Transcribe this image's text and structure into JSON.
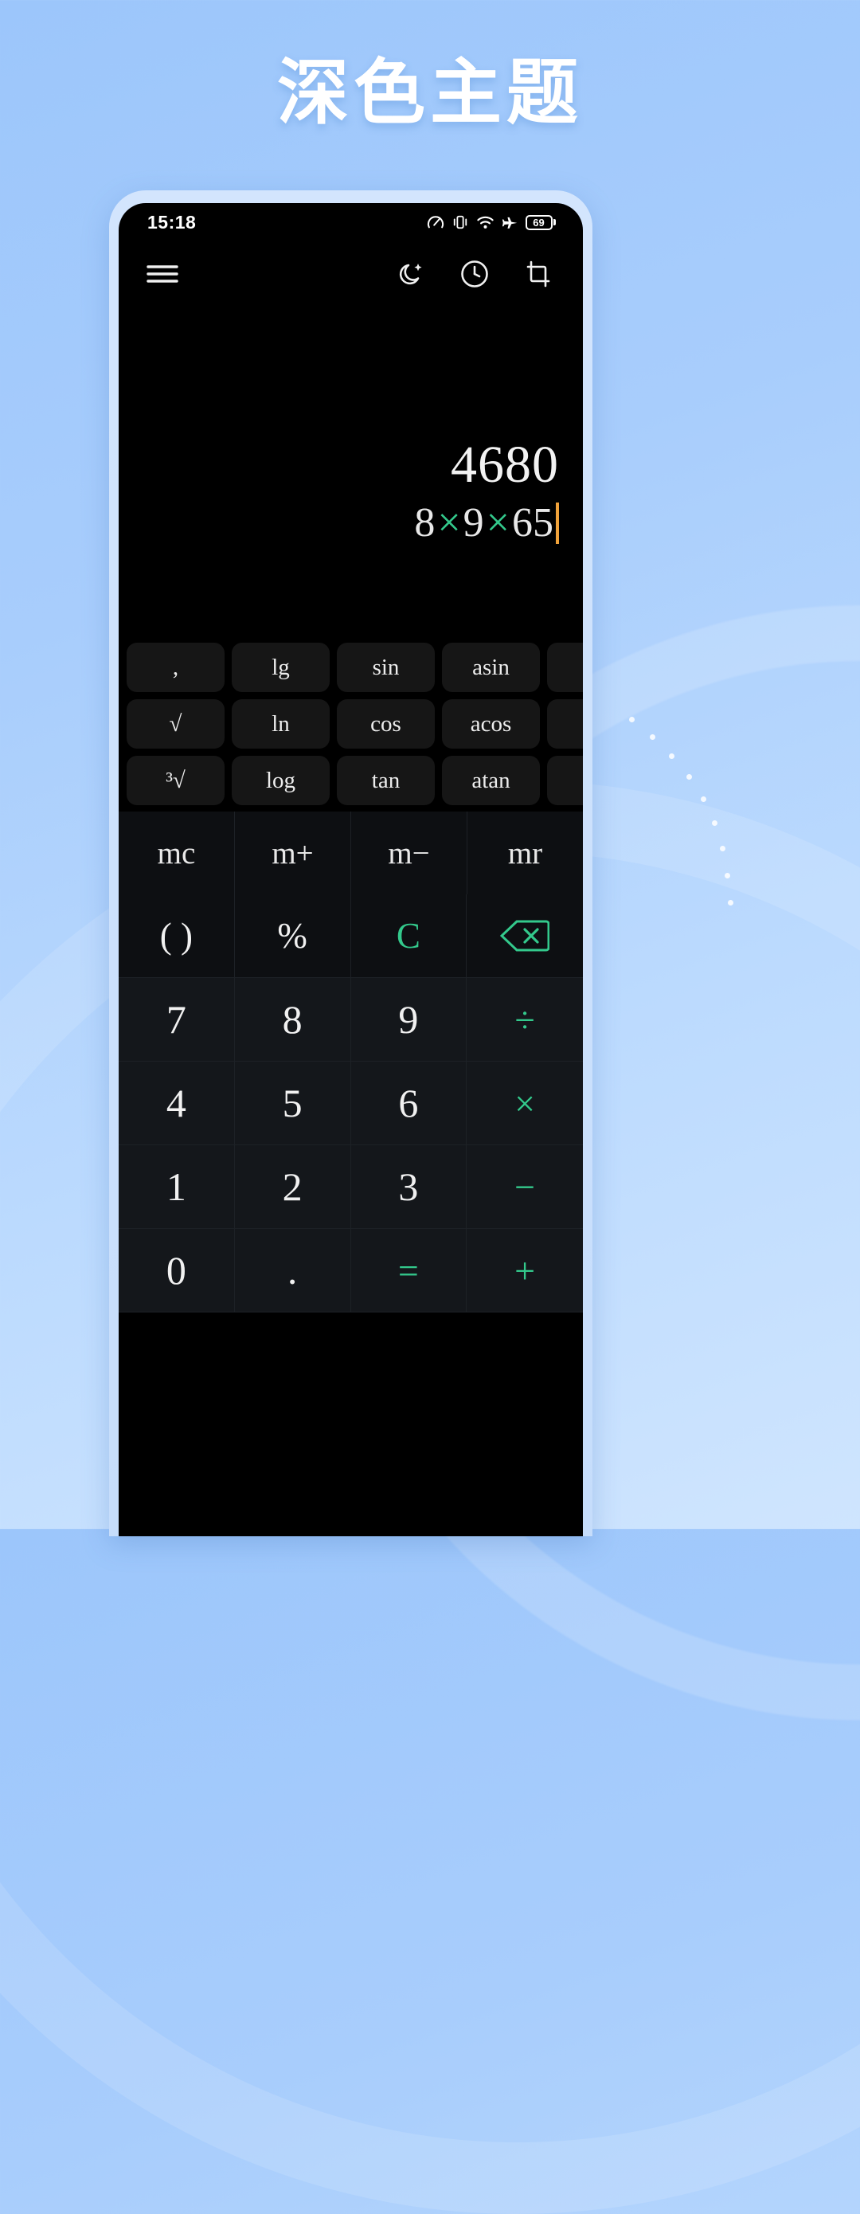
{
  "page": {
    "title": "深色主题",
    "background_accent": "#9cc6fb"
  },
  "statusbar": {
    "time": "15:18",
    "icons": [
      "speedometer-icon",
      "vibrate-icon",
      "wifi-icon",
      "airplane-icon",
      "battery-icon"
    ],
    "battery_level": "69"
  },
  "toolbar": {
    "menu": "menu-icon",
    "theme": "moon-icon",
    "history": "clock-icon",
    "screenshot": "crop-icon"
  },
  "display": {
    "result": "4680",
    "expression_parts": [
      {
        "text": "8",
        "type": "num"
      },
      {
        "text": "×",
        "type": "op"
      },
      {
        "text": "9",
        "type": "num"
      },
      {
        "text": "×",
        "type": "op"
      },
      {
        "text": "65",
        "type": "num"
      }
    ],
    "expression_plain": "8×9×65",
    "cursor_color": "#f0a23a",
    "operator_color": "#33c98c"
  },
  "scientific": {
    "rows": [
      [
        ",",
        "lg",
        "sin",
        "asin",
        ""
      ],
      [
        "√",
        "ln",
        "cos",
        "acos",
        ""
      ],
      [
        "³√",
        "log",
        "tan",
        "atan",
        ""
      ]
    ]
  },
  "memory": {
    "keys": [
      "mc",
      "m+",
      "m−",
      "mr"
    ]
  },
  "keypad": {
    "rows": [
      [
        {
          "label": "( )",
          "style": "fn"
        },
        {
          "label": "%",
          "style": "fn"
        },
        {
          "label": "C",
          "style": "green"
        },
        {
          "label": "backspace-icon",
          "style": "green-icon"
        }
      ],
      [
        {
          "label": "7",
          "style": "num"
        },
        {
          "label": "8",
          "style": "num"
        },
        {
          "label": "9",
          "style": "num"
        },
        {
          "label": "÷",
          "style": "op"
        }
      ],
      [
        {
          "label": "4",
          "style": "num"
        },
        {
          "label": "5",
          "style": "num"
        },
        {
          "label": "6",
          "style": "num"
        },
        {
          "label": "×",
          "style": "op"
        }
      ],
      [
        {
          "label": "1",
          "style": "num"
        },
        {
          "label": "2",
          "style": "num"
        },
        {
          "label": "3",
          "style": "num"
        },
        {
          "label": "−",
          "style": "op"
        }
      ],
      [
        {
          "label": "0",
          "style": "num"
        },
        {
          "label": ".",
          "style": "num"
        },
        {
          "label": "=",
          "style": "op"
        },
        {
          "label": "+",
          "style": "op"
        }
      ]
    ]
  }
}
